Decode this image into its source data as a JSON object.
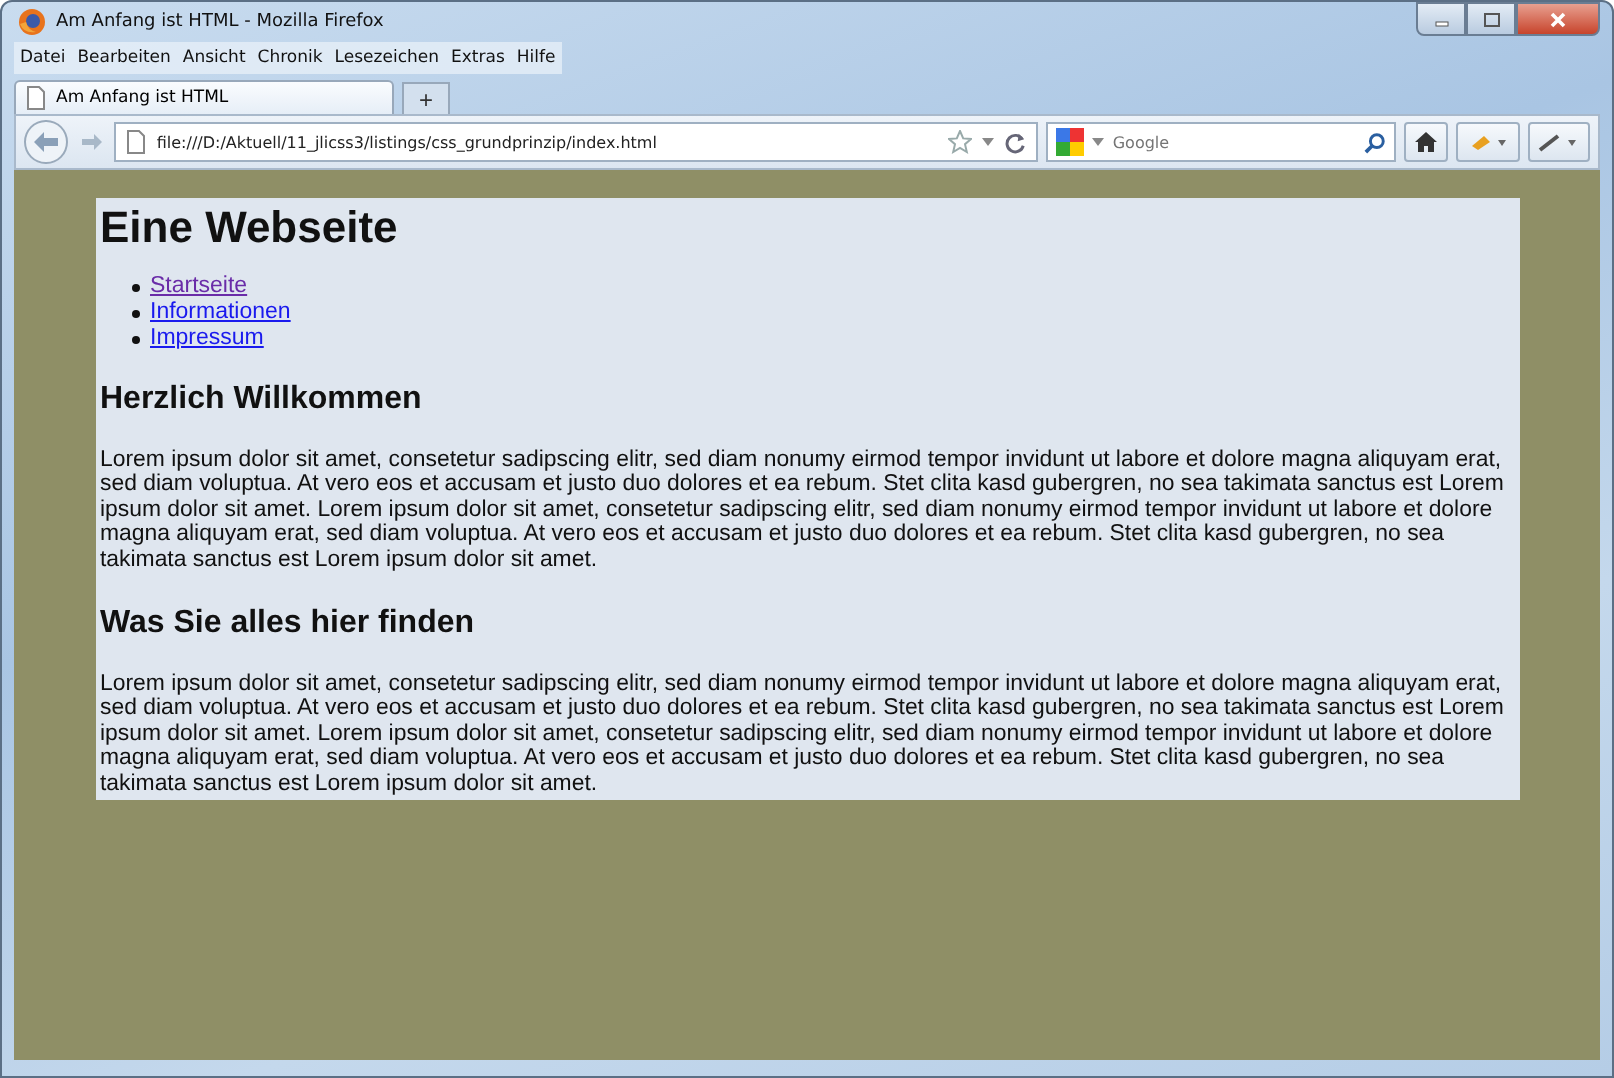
{
  "window": {
    "title": "Am Anfang ist HTML - Mozilla Firefox"
  },
  "menu": [
    "Datei",
    "Bearbeiten",
    "Ansicht",
    "Chronik",
    "Lesezeichen",
    "Extras",
    "Hilfe"
  ],
  "tabs": [
    {
      "label": "Am Anfang ist HTML",
      "selected": true
    }
  ],
  "new_tab": "+",
  "address_bar": {
    "value": "file:///D:/Aktuell/11_jlicss3/listings/css_grundprinzip/index.html"
  },
  "search": {
    "placeholder": "Google"
  },
  "page": {
    "heading": "Eine Webseite",
    "nav": [
      {
        "label": "Startseite",
        "visited": true
      },
      {
        "label": "Informationen",
        "visited": false
      },
      {
        "label": "Impressum",
        "visited": false
      }
    ],
    "sections": [
      {
        "heading": "Herzlich Willkommen",
        "text": "Lorem ipsum dolor sit amet, consetetur sadipscing elitr, sed diam nonumy eirmod tempor invidunt ut labore et dolore magna aliquyam erat, sed diam voluptua. At vero eos et accusam et justo duo dolores et ea rebum. Stet clita kasd gubergren, no sea takimata sanctus est Lorem ipsum dolor sit amet. Lorem ipsum dolor sit amet, consetetur sadipscing elitr, sed diam nonumy eirmod tempor invidunt ut labore et dolore magna aliquyam erat, sed diam voluptua. At vero eos et accusam et justo duo dolores et ea rebum. Stet clita kasd gubergren, no sea takimata sanctus est Lorem ipsum dolor sit amet."
      },
      {
        "heading": "Was Sie alles hier finden",
        "text": "Lorem ipsum dolor sit amet, consetetur sadipscing elitr, sed diam nonumy eirmod tempor invidunt ut labore et dolore magna aliquyam erat, sed diam voluptua. At vero eos et accusam et justo duo dolores et ea rebum. Stet clita kasd gubergren, no sea takimata sanctus est Lorem ipsum dolor sit amet. Lorem ipsum dolor sit amet, consetetur sadipscing elitr, sed diam nonumy eirmod tempor invidunt ut labore et dolore magna aliquyam erat, sed diam voluptua. At vero eos et accusam et justo duo dolores et ea rebum. Stet clita kasd gubergren, no sea takimata sanctus est Lorem ipsum dolor sit amet."
      }
    ]
  }
}
